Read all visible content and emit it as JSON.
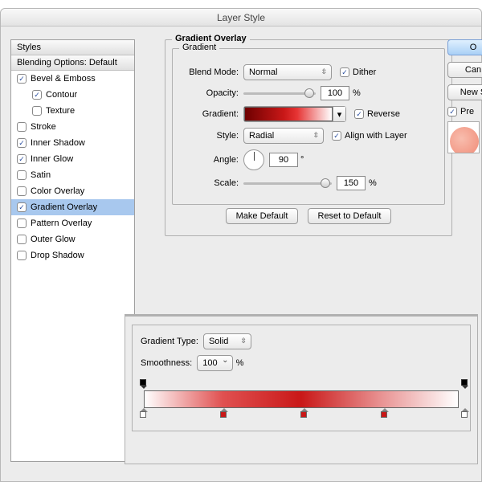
{
  "title": "Layer Style",
  "sidebar": {
    "header1": "Styles",
    "header2": "Blending Options: Default",
    "items": [
      {
        "label": "Bevel & Emboss",
        "on": true,
        "indent": 0
      },
      {
        "label": "Contour",
        "on": true,
        "indent": 1
      },
      {
        "label": "Texture",
        "on": false,
        "indent": 1
      },
      {
        "label": "Stroke",
        "on": false,
        "indent": 0
      },
      {
        "label": "Inner Shadow",
        "on": true,
        "indent": 0
      },
      {
        "label": "Inner Glow",
        "on": true,
        "indent": 0
      },
      {
        "label": "Satin",
        "on": false,
        "indent": 0
      },
      {
        "label": "Color Overlay",
        "on": false,
        "indent": 0
      },
      {
        "label": "Gradient Overlay",
        "on": true,
        "indent": 0,
        "sel": true
      },
      {
        "label": "Pattern Overlay",
        "on": false,
        "indent": 0
      },
      {
        "label": "Outer Glow",
        "on": false,
        "indent": 0
      },
      {
        "label": "Drop Shadow",
        "on": false,
        "indent": 0
      }
    ]
  },
  "panel": {
    "title": "Gradient Overlay",
    "subtitle": "Gradient",
    "labels": {
      "blend": "Blend Mode:",
      "opacity": "Opacity:",
      "gradient": "Gradient:",
      "style": "Style:",
      "angle": "Angle:",
      "scale": "Scale:"
    },
    "blend_mode": "Normal",
    "dither_label": "Dither",
    "dither": true,
    "opacity": "100",
    "opacity_suffix": "%",
    "reverse_label": "Reverse",
    "reverse": true,
    "style": "Radial",
    "align_label": "Align with Layer",
    "align": true,
    "angle": "90",
    "angle_suffix": "°",
    "scale": "150",
    "scale_suffix": "%",
    "make_default": "Make Default",
    "reset": "Reset to Default"
  },
  "right": {
    "ok": "O",
    "cancel": "Can",
    "newstyle": "New S",
    "preview_label": "Pre",
    "preview": true
  },
  "editor": {
    "type_label": "Gradient Type:",
    "type": "Solid",
    "smooth_label": "Smoothness:",
    "smooth": "100",
    "smooth_suffix": "%",
    "top_stops": [
      0,
      100
    ],
    "bot_stops": [
      {
        "pos": 0,
        "color": "#fff"
      },
      {
        "pos": 25,
        "color": "#c91818"
      },
      {
        "pos": 50,
        "color": "#c91818"
      },
      {
        "pos": 75,
        "color": "#c91818"
      },
      {
        "pos": 100,
        "color": "#fff"
      }
    ]
  }
}
